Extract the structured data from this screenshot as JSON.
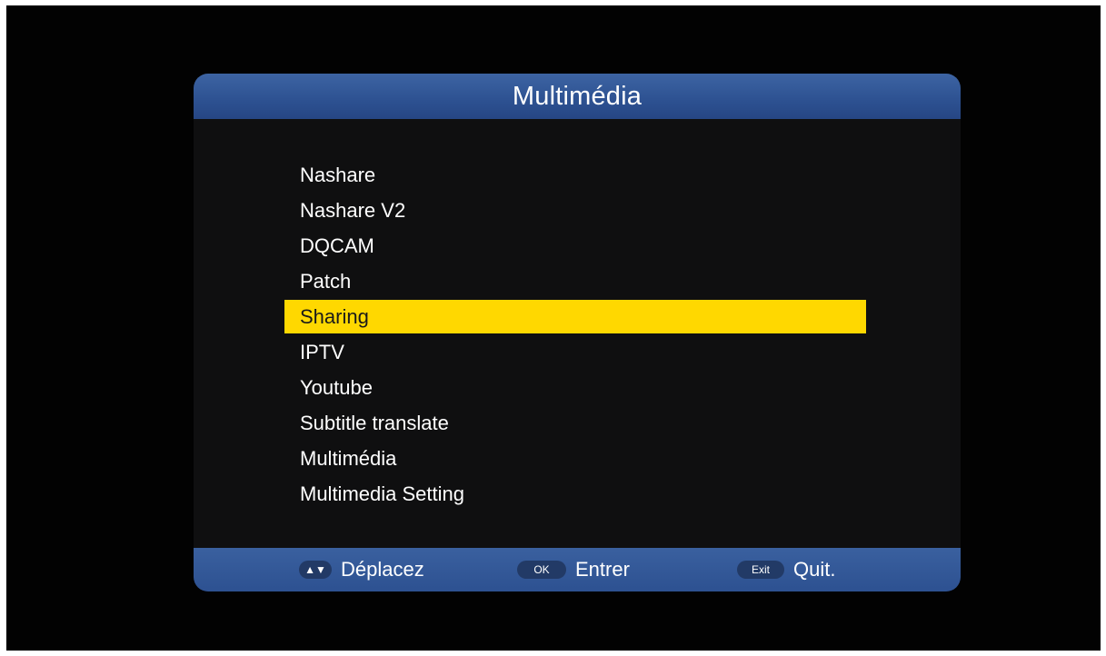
{
  "dialog": {
    "title": "Multimédia"
  },
  "menu": {
    "selected_index": 4,
    "items": [
      {
        "label": "Nashare"
      },
      {
        "label": "Nashare V2"
      },
      {
        "label": "DQCAM"
      },
      {
        "label": "Patch"
      },
      {
        "label": "Sharing"
      },
      {
        "label": "IPTV"
      },
      {
        "label": "Youtube"
      },
      {
        "label": "Subtitle translate"
      },
      {
        "label": "Multimédia"
      },
      {
        "label": "Multimedia Setting"
      }
    ]
  },
  "footer": {
    "move": {
      "key": "▲▼",
      "label": "Déplacez"
    },
    "ok": {
      "key": "OK",
      "label": "Entrer"
    },
    "exit": {
      "key": "Exit",
      "label": "Quit."
    }
  },
  "colors": {
    "header_blue": "#2d5191",
    "highlight_yellow": "#ffd800",
    "panel_background": "#0f0f10"
  }
}
